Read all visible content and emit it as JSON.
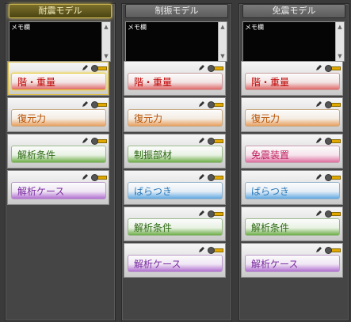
{
  "columns": [
    {
      "title": "耐震モデル",
      "active": true,
      "memo": "メモ欄",
      "cards": [
        {
          "label": "階・重量",
          "color": "red",
          "active": true
        },
        {
          "label": "復元力",
          "color": "orange"
        },
        {
          "label": "解析条件",
          "color": "green"
        },
        {
          "label": "解析ケース",
          "color": "purple"
        }
      ]
    },
    {
      "title": "制振モデル",
      "memo": "メモ欄",
      "cards": [
        {
          "label": "階・重量",
          "color": "red"
        },
        {
          "label": "復元力",
          "color": "orange"
        },
        {
          "label": "制振部材",
          "color": "green"
        },
        {
          "label": "ばらつき",
          "color": "blue"
        },
        {
          "label": "解析条件",
          "color": "green"
        },
        {
          "label": "解析ケース",
          "color": "purple"
        }
      ]
    },
    {
      "title": "免震モデル",
      "memo": "メモ欄",
      "cards": [
        {
          "label": "階・重量",
          "color": "red"
        },
        {
          "label": "復元力",
          "color": "orange"
        },
        {
          "label": "免震装置",
          "color": "pink"
        },
        {
          "label": "ばらつき",
          "color": "blue"
        },
        {
          "label": "解析条件",
          "color": "green"
        },
        {
          "label": "解析ケース",
          "color": "purple"
        }
      ]
    }
  ],
  "icons": {
    "edit": "pencil-icon",
    "toggle": "toggle-icon",
    "scroll_up": "scroll-up-arrow-icon",
    "scroll_down": "scroll-down-arrow-icon"
  }
}
